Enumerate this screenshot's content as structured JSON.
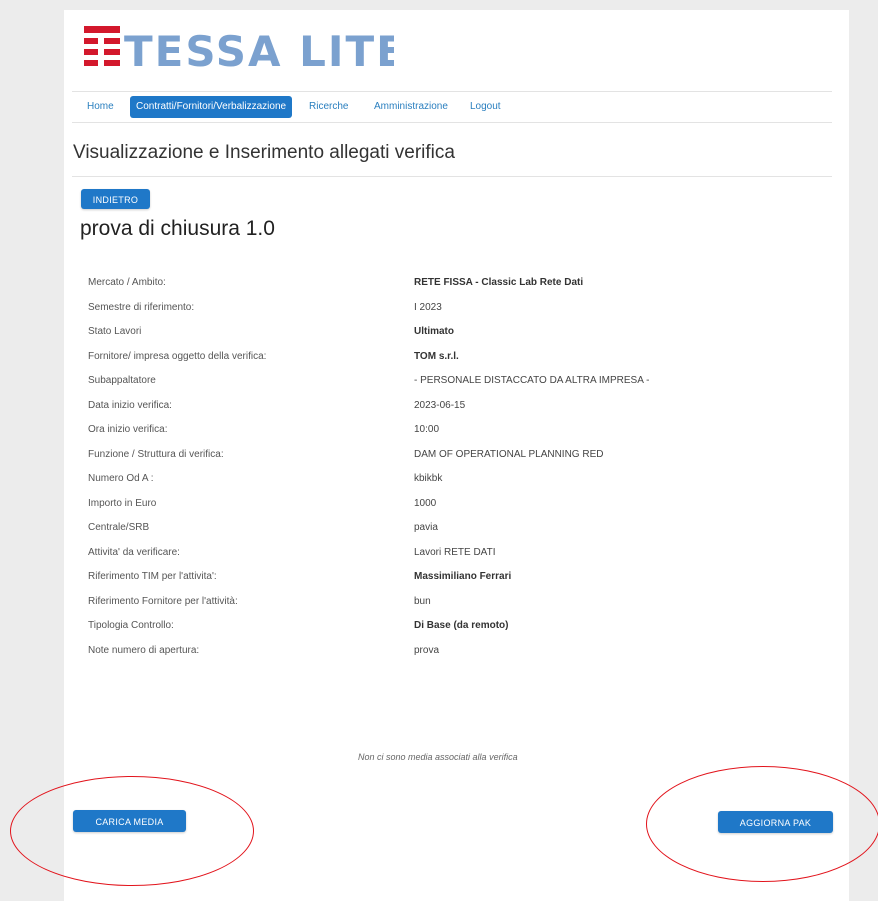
{
  "brand": {
    "logo_text": "TESSA LITE"
  },
  "nav": {
    "items": [
      {
        "label": "Home"
      },
      {
        "label": "Contratti/Fornitori/Verbalizzazione"
      },
      {
        "label": "Ricerche"
      },
      {
        "label": "Amministrazione"
      },
      {
        "label": "Logout"
      }
    ]
  },
  "page": {
    "title": "Visualizzazione e Inserimento allegati verifica"
  },
  "buttons": {
    "back": "INDIETRO",
    "upload_media": "CARICA MEDIA",
    "right_action": "AGGIORNA PAK"
  },
  "record": {
    "title": "prova di chiusura 1.0",
    "rows": [
      {
        "label": "Mercato / Ambito:",
        "value": "RETE FISSA - Classic Lab Rete Dati",
        "bold": true
      },
      {
        "label": "Semestre di riferimento:",
        "value": "I 2023",
        "bold": false
      },
      {
        "label": "Stato Lavori",
        "value": "Ultimato",
        "bold": true
      },
      {
        "label": "Fornitore/ impresa oggetto della verifica:",
        "value": "TOM s.r.l.",
        "bold": true
      },
      {
        "label": "Subappaltatore",
        "value": "- PERSONALE DISTACCATO DA ALTRA IMPRESA -",
        "bold": false
      },
      {
        "label": "Data inizio verifica:",
        "value": "2023-06-15",
        "bold": false
      },
      {
        "label": "Ora inizio verifica:",
        "value": "10:00",
        "bold": false
      },
      {
        "label": "Funzione / Struttura di verifica:",
        "value": "DAM OF OPERATIONAL PLANNING RED",
        "bold": false
      },
      {
        "label": "Numero Od A :",
        "value": "kbikbk",
        "bold": false
      },
      {
        "label": "Importo in Euro",
        "value": "1000",
        "bold": false
      },
      {
        "label": "Centrale/SRB",
        "value": "pavia",
        "bold": false
      },
      {
        "label": "Attivita' da verificare:",
        "value": "Lavori RETE DATI",
        "bold": false
      },
      {
        "label": "Riferimento TIM per l'attivita':",
        "value": "Massimiliano Ferrari",
        "bold": true
      },
      {
        "label": "Riferimento Fornitore per l'attività:",
        "value": "bun",
        "bold": false
      },
      {
        "label": "Tipologia Controllo:",
        "value": "Di Base (da remoto)",
        "bold": true
      },
      {
        "label": "Note numero di apertura:",
        "value": "prova",
        "bold": false
      }
    ]
  },
  "note": "Non ci sono media associati alla verifica",
  "colors": {
    "primary": "#1f78c8",
    "brand_red": "#d3182c",
    "brand_blue": "#7ba1cf",
    "highlight_ring": "#e2141c"
  }
}
